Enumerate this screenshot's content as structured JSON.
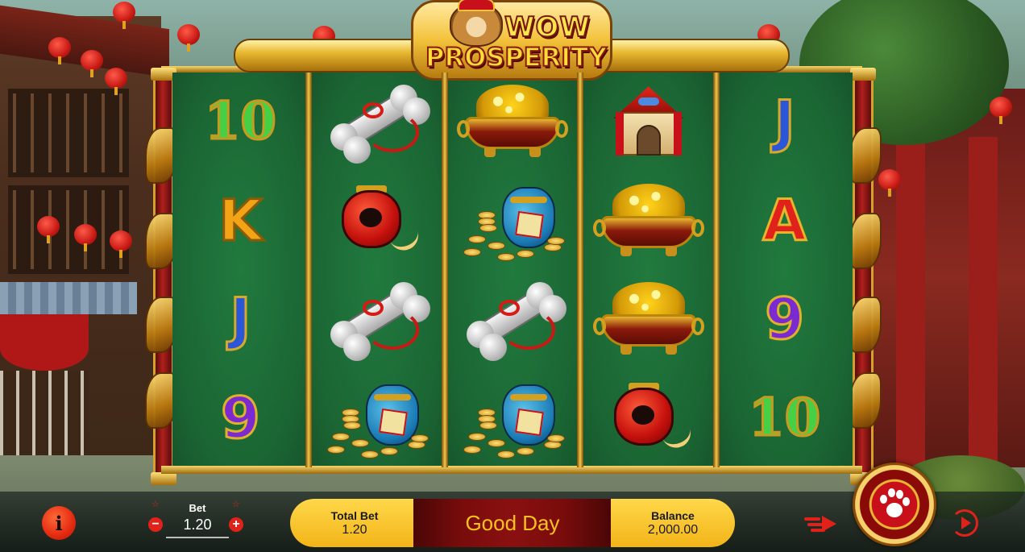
{
  "game": {
    "title_top": "WOW",
    "title_main": "PROSPERITY"
  },
  "reels": [
    [
      "10",
      "K",
      "J",
      "9"
    ],
    [
      "silver-bone-icon",
      "red-lantern-icon",
      "silver-bone-icon",
      "money-bag-icon"
    ],
    [
      "gold-pot-icon",
      "money-bag-icon",
      "silver-bone-icon",
      "money-bag-icon"
    ],
    [
      "dog-house-icon",
      "gold-pot-icon",
      "gold-pot-icon",
      "red-lantern-icon"
    ],
    [
      "J",
      "A",
      "9",
      "10"
    ]
  ],
  "controls": {
    "bet_label": "Bet",
    "bet_value": "1.20",
    "total_bet_label": "Total Bet",
    "total_bet_value": "1.20",
    "message": "Good Day",
    "balance_label": "Balance",
    "balance_value": "2,000.00",
    "minus_glyph": "−",
    "plus_glyph": "+",
    "info_glyph": "i"
  },
  "colors": {
    "accent_red": "#e0221a",
    "pill_yellow": "#ffd84a",
    "message_gold": "#ffc21a",
    "reel_green": "#1b6634"
  }
}
